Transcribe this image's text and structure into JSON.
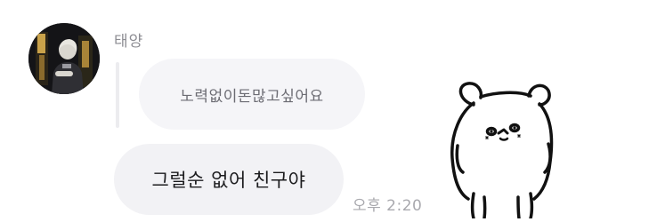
{
  "chat": {
    "sender_name": "태양",
    "quoted_message": "노력없이돈많고싶어요",
    "reply_message": "그럴순 없어 친구야",
    "timestamp": "오후 2:20"
  },
  "sticker": {
    "icon": "white-bear-sticker-icon"
  },
  "colors": {
    "bubble_background": "#f2f2f5",
    "quoted_background": "#f5f5f8",
    "name_text": "#8d8d93",
    "time_text": "#a9a9ae"
  }
}
